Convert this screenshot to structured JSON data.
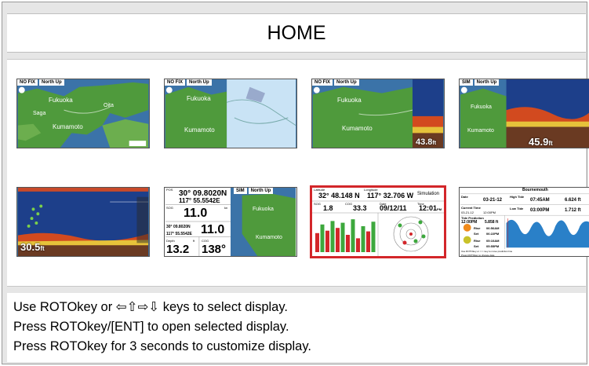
{
  "title": "HOME",
  "tiles": {
    "t1": {
      "hdr": [
        "NO FIX",
        "North Up"
      ],
      "place_a": "Fukuoka",
      "place_b": "Kumamoto",
      "place_c": "Saga",
      "place_d": "Oita"
    },
    "t2": {
      "hdr": [
        "NO FIX",
        "North Up"
      ],
      "place_a": "Fukuoka",
      "place_b": "Kumamoto"
    },
    "t3": {
      "hdr": [
        "NO FIX",
        "North Up"
      ],
      "place_a": "Fukuoka",
      "place_b": "Kumamoto",
      "depth": "43.8",
      "depth_unit": "ft"
    },
    "t4": {
      "hdr": [
        "SIM",
        "North Up"
      ],
      "place_a": "Fukuoka",
      "place_b": "Kumamoto",
      "depth": "45.9",
      "depth_unit": "ft"
    },
    "t5": {
      "depth": "30.5",
      "depth_unit": "ft"
    },
    "t6": {
      "hdr": [
        "SIM",
        "North Up"
      ],
      "pos_label": "POS",
      "lat": "30° 09.8020N",
      "lon": "117° 55.5542E",
      "sog_label": "SOG",
      "sog_unit": "kn",
      "sog": "11.0",
      "pos2_lat": "30° 09.8020N",
      "pos2_lon": "117° 55.5542E",
      "sog2": "11.0",
      "depth_label": "Depth",
      "depth_unit": "ft",
      "cog_label": "COG",
      "depth": "13.2",
      "cog": "138°",
      "place_a": "Fukuoka",
      "place_b": "Kumamoto"
    },
    "t7": {
      "lat_label": "Latitude",
      "lat": "32° 48.148 N",
      "lon_label": "Longitude",
      "lon": "117° 32.706 W",
      "mode": "Simulation",
      "sog_label": "SOG",
      "sog": "1.8",
      "cog_label": "COG",
      "cog": "33.3",
      "date_label": "Date",
      "date": "09/12/11",
      "time_label": "Time",
      "time": "12:01",
      "ampm": "PM",
      "bars": [
        0.55,
        0.8,
        0.62,
        0.9,
        0.7,
        0.85,
        0.5,
        0.95,
        0.4,
        0.75,
        0.6,
        0.88
      ]
    },
    "t8": {
      "location": "Bournemouth",
      "date_label": "Date",
      "date": "03-21-12",
      "high_label": "High Tide",
      "high_time": "07:45AM",
      "high_height": "6.624 ft",
      "current_label": "Current Time",
      "current_date": "03-21-12",
      "current_time": "12:00PM",
      "low_label": "Low Tide",
      "low_time": "03:00PM",
      "low_height": "1.712 ft",
      "pred_label": "Tide Prediction",
      "pred_time": "12:00PM",
      "pred_height": "5.858 ft",
      "sun_rise_label": "Rise",
      "sun_rise": "06:56AM",
      "sun_set_label": "Set",
      "sun_set": "06:22PM",
      "moon_rise_label": "Rise",
      "moon_rise": "05:10AM",
      "moon_set_label": "Set",
      "moon_set": "05:55PM",
      "note1": "Use ROTOkey or ⇦⇨ key to move prediction line",
      "note2": "Press ROTOkey to change date"
    }
  },
  "instructions": [
    "Use ROTOkey or ⇦⇧⇨⇩ keys to select display.",
    "Press ROTOkey/[ENT] to open selected display.",
    "Press ROTOkey for 3 seconds to customize display."
  ],
  "colors": {
    "selection": "#d3262a",
    "sea": "#3b73a8",
    "land": "#4f9a3c",
    "sonar_bg": "#1d3f8a"
  }
}
